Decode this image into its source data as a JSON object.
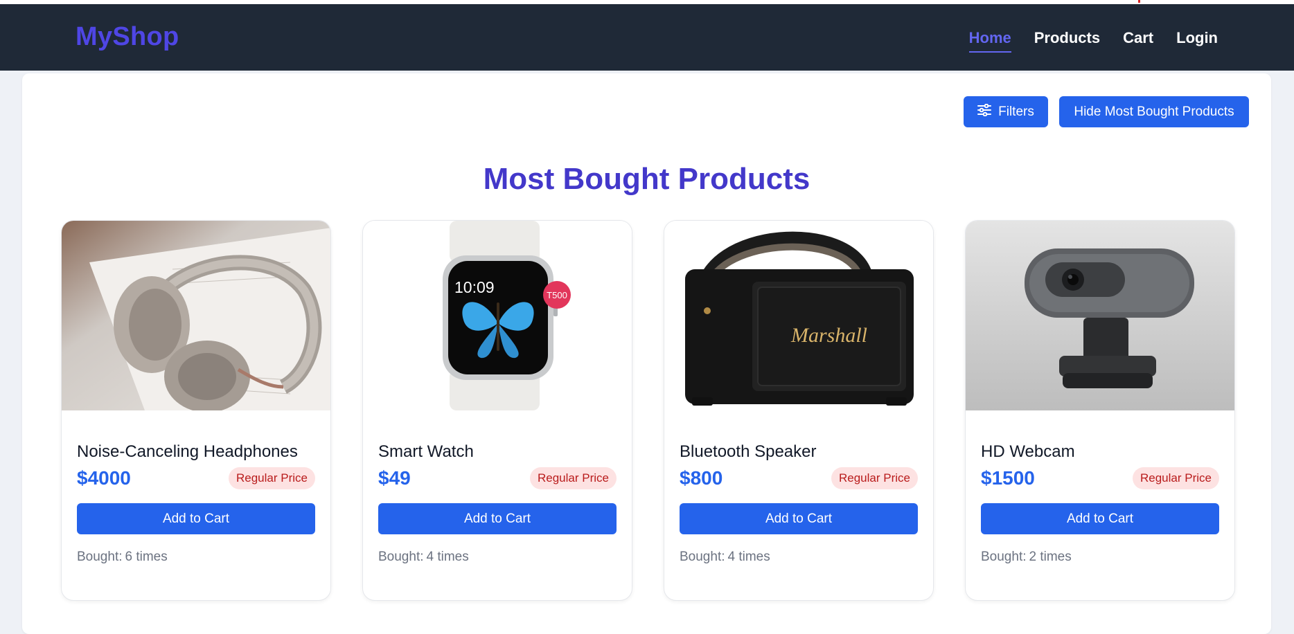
{
  "brand": "MyShop",
  "nav": [
    {
      "label": "Home",
      "active": true
    },
    {
      "label": "Products",
      "active": false
    },
    {
      "label": "Cart",
      "active": false
    },
    {
      "label": "Login",
      "active": false
    }
  ],
  "toolbar": {
    "filters_label": "Filters",
    "filters_icon": "sliders-icon",
    "hide_label": "Hide Most Bought Products"
  },
  "section_title": "Most Bought Products",
  "products": [
    {
      "name": "Noise-Canceling Headphones",
      "price": "$4000",
      "badge": "Regular Price",
      "add_label": "Add to Cart",
      "bought_label": "Bought:",
      "bought_count": "6 times",
      "image": "headphones"
    },
    {
      "name": "Smart Watch",
      "price": "$49",
      "badge": "Regular Price",
      "add_label": "Add to Cart",
      "bought_label": "Bought:",
      "bought_count": "4 times",
      "image": "smart-watch",
      "watch_time": "10:09",
      "watch_tag": "T500"
    },
    {
      "name": "Bluetooth Speaker",
      "price": "$800",
      "badge": "Regular Price",
      "add_label": "Add to Cart",
      "bought_label": "Bought:",
      "bought_count": "4 times",
      "image": "speaker",
      "speaker_brand": "Marshall"
    },
    {
      "name": "HD Webcam",
      "price": "$1500",
      "badge": "Regular Price",
      "add_label": "Add to Cart",
      "bought_label": "Bought:",
      "bought_count": "2 times",
      "image": "webcam"
    }
  ],
  "colors": {
    "navbar": "#1f2937",
    "brand": "#4f46e5",
    "accent": "#2563eb",
    "title": "#4338ca",
    "badge_bg": "#fde2e2",
    "badge_text": "#b91c1c"
  }
}
